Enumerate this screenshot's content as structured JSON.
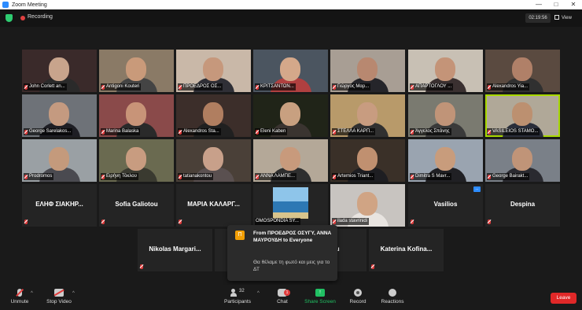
{
  "window": {
    "title": "Zoom Meeting"
  },
  "topbar": {
    "recording_label": "Recording",
    "timer": "02:19:56",
    "view_label": "View"
  },
  "participants": [
    {
      "name": "John Corlett an...",
      "bg": "#3a2a2a",
      "skin": "#c8a48c",
      "shirt": "#2a2a2a"
    },
    {
      "name": "Antigoni Kouteri",
      "bg": "#8a7a66",
      "skin": "#c99a7a",
      "shirt": "#444444"
    },
    {
      "name": "ΠΡΟΕΔΡΟΣ ΟΣ...",
      "bg": "#c9b8a8",
      "skin": "#c6987c",
      "shirt": "#2f2f36"
    },
    {
      "name": "ΚΡΙΤΣΑΝΤΩΝ...",
      "bg": "#4b5560",
      "skin": "#d4a88a",
      "shirt": "#b04040"
    },
    {
      "name": "Γιώργος Μαρ...",
      "bg": "#a89e94",
      "skin": "#b88870",
      "shirt": "#25252a"
    },
    {
      "name": "ΑΠΑΡΤΟΓΛΟΥ ...",
      "bg": "#c8c0b4",
      "skin": "#c49478",
      "shirt": "#3a3030"
    },
    {
      "name": "Alexandros Yia...",
      "bg": "#5a4a40",
      "skin": "#b08068",
      "shirt": "#303030"
    },
    {
      "name": "George Sarelakos...",
      "bg": "#6e7278",
      "skin": "#c49a80",
      "shirt": "#1e1e24"
    },
    {
      "name": "Marina Balaska",
      "bg": "#8a4a4a",
      "skin": "#c89478",
      "shirt": "#2a2a2a"
    },
    {
      "name": "Alexandros Sta...",
      "bg": "#3c2e2a",
      "skin": "#b07e60",
      "shirt": "#202020"
    },
    {
      "name": "Eleni Kaben",
      "bg": "#202418",
      "skin": "#c8a080",
      "shirt": "#3a3430"
    },
    {
      "name": "ΣΤΕΛΛΑ ΚΑΡΠ...",
      "bg": "#b89a6a",
      "skin": "#c89c80",
      "shirt": "#303030"
    },
    {
      "name": "Άγγελος Σπάνης",
      "bg": "#7a7a70",
      "skin": "#c09478",
      "shirt": "#3a3a3a"
    },
    {
      "name": "VASILEIOS STAMO...",
      "bg": "#b0a898",
      "skin": "#bc9070",
      "shirt": "#2a2e3a"
    },
    {
      "name": "Prodromos",
      "bg": "#9aa0a4",
      "skin": "#c49a7c",
      "shirt": "#4a4a50"
    },
    {
      "name": "Ειρήνη Τόκλου",
      "bg": "#6a6a50",
      "skin": "#c89c80",
      "shirt": "#3a3a30"
    },
    {
      "name": "tatianakontou",
      "bg": "#4a4038",
      "skin": "#c8a08a",
      "shirt": "#5a5050"
    },
    {
      "name": "ΑΝΝΑ ΛΑΜΠΕ...",
      "bg": "#b4a898",
      "skin": "#c89a7c",
      "shirt": "#2e2e2e"
    },
    {
      "name": "Artemios Triant...",
      "bg": "#3a3028",
      "skin": "#c09070",
      "shirt": "#1e1e22"
    },
    {
      "name": "Dimitra S Mavr...",
      "bg": "#9aa4b0",
      "skin": "#c89c7c",
      "shirt": "#202024"
    },
    {
      "name": "George Bairakt...",
      "bg": "#7a8088",
      "skin": "#c09478",
      "shirt": "#2a2a30"
    },
    {
      "name": "ilada stavrinidi",
      "bg": "#c8c4c0",
      "skin": "#d0a484",
      "shirt": "#e8e4e0"
    }
  ],
  "name_tiles": [
    {
      "name": "ΕΛΗΦ ΣΙΑΚΗΡ..."
    },
    {
      "name": "Sofia Galiotou"
    },
    {
      "name": "ΜΑΡΙΑ ΚΑΛΑΡΓ..."
    },
    {
      "name": "Vasilios"
    },
    {
      "name": "Despina"
    },
    {
      "name": "Nikolas Margari..."
    },
    {
      "name": "enidou"
    },
    {
      "name": "Katerina Kofina..."
    }
  ],
  "photo_tile": {
    "name": "OMOSPONDIA SY..."
  },
  "more_label": "...",
  "toast": {
    "avatar_letter": "Π",
    "from": "From ΠΡΟΕΔΡΟΣ ΟΣΥΓΥ, ΑΝΝΑ ΜΑΥΡΟΥΔΗ to Everyone",
    "message": "Θα θέλαμε τη φωτό και μεις για το ΔΤ"
  },
  "toolbar": {
    "unmute": "Unmute",
    "stop_video": "Stop Video",
    "participants": "Participants",
    "participants_count": "32",
    "chat": "Chat",
    "chat_badge": "1",
    "share_screen": "Share Screen",
    "record": "Record",
    "reactions": "Reactions",
    "leave": "Leave"
  },
  "colors": {
    "active_speaker": "#a8d800",
    "share_green": "#21c063",
    "leave_red": "#e02828",
    "accent_blue": "#2d8cff"
  }
}
